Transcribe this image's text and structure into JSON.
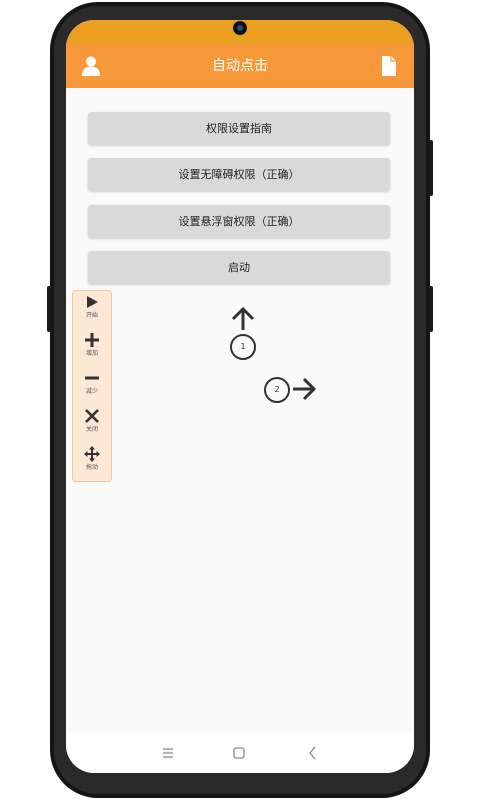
{
  "app": {
    "title": "自动点击",
    "accent_color": "#f7993b",
    "status_bar_color": "#eba021"
  },
  "appbar": {
    "left_icon": "user-icon",
    "right_icon": "document-icon"
  },
  "buttons": [
    {
      "label": "权限设置指南"
    },
    {
      "label": "设置无障碍权限（正确）"
    },
    {
      "label": "设置悬浮窗权限（正确）"
    },
    {
      "label": "启动"
    }
  ],
  "float_panel": {
    "items": [
      {
        "icon": "play-icon",
        "label": "开始"
      },
      {
        "icon": "plus-icon",
        "label": "增加"
      },
      {
        "icon": "minus-icon",
        "label": "减少"
      },
      {
        "icon": "close-icon",
        "label": "关闭"
      },
      {
        "icon": "move-icon",
        "label": "拖动"
      }
    ]
  },
  "markers": [
    {
      "number": "1",
      "arrow": "up-arrow-icon"
    },
    {
      "number": "2",
      "arrow": "right-arrow-icon"
    }
  ],
  "navbar": {
    "icons": [
      "menu-icon",
      "home-icon",
      "back-icon"
    ]
  }
}
